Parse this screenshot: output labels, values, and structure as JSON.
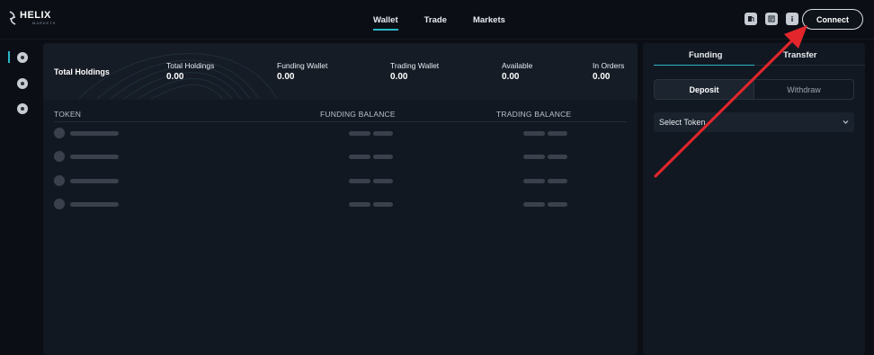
{
  "brand": {
    "name": "HELIX",
    "sub": "MARKETS",
    "mark_icon": "helix-logo-icon"
  },
  "nav": {
    "items": [
      {
        "label": "Wallet",
        "active": true
      },
      {
        "label": "Trade",
        "active": false
      },
      {
        "label": "Markets",
        "active": false
      }
    ]
  },
  "header_icons": [
    "gas-icon",
    "notes-icon",
    "info-icon"
  ],
  "connect": {
    "label": "Connect"
  },
  "sidebar": {
    "icons": [
      "wallet-icon",
      "history-icon",
      "staking-icon"
    ]
  },
  "holdings": {
    "title": "Total Holdings",
    "stats": [
      {
        "label": "Total Holdings",
        "value": "0.00"
      },
      {
        "label": "Funding Wallet",
        "value": "0.00"
      },
      {
        "label": "Trading Wallet",
        "value": "0.00"
      },
      {
        "label": "Available",
        "value": "0.00"
      },
      {
        "label": "In Orders",
        "value": "0.00"
      }
    ]
  },
  "table": {
    "headers": {
      "token": "TOKEN",
      "funding": "FUNDING BALANCE",
      "trading": "TRADING BALANCE"
    },
    "skeleton_rows": 4
  },
  "side": {
    "tabs": [
      {
        "label": "Funding",
        "active": true
      },
      {
        "label": "Transfer",
        "active": false
      }
    ],
    "segment": {
      "deposit": "Deposit",
      "withdraw": "Withdraw"
    },
    "select": {
      "placeholder": "Select Token"
    }
  },
  "colors": {
    "accent": "#2bb6c8",
    "background": "#0b0f15",
    "panel": "#121821",
    "annotation_arrow": "#e3262b"
  }
}
